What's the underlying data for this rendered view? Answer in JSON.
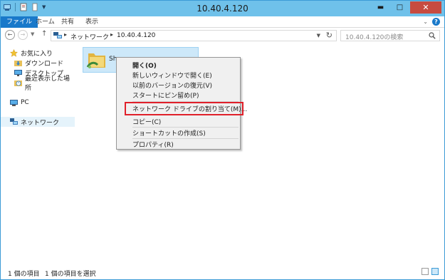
{
  "window": {
    "title": "10.40.4.120",
    "minimize": "▬",
    "maximize": "□",
    "close": "✕"
  },
  "ribbon": {
    "tabs": [
      "ファイル",
      "ホーム",
      "共有",
      "表示"
    ],
    "help": "?"
  },
  "address": {
    "crumbs": [
      "ネットワーク",
      "10.40.4.120"
    ],
    "search_placeholder": "10.40.4.120の検索"
  },
  "nav": {
    "favorites": "お気に入り",
    "downloads": "ダウンロード",
    "desktop": "デスクトップ",
    "recent": "最近表示した場所",
    "pc": "PC",
    "network": "ネットワーク"
  },
  "content": {
    "folder_label": "Sh"
  },
  "context_menu": {
    "items": [
      "開く(O)",
      "新しいウィンドウで開く(E)",
      "以前のバージョンの復元(V)",
      "スタートにピン留め(P)",
      "ネットワーク ドライブの割り当て(M)...",
      "コピー(C)",
      "ショートカットの作成(S)",
      "プロパティ(R)"
    ]
  },
  "status": {
    "count": "1 個の項目",
    "selected": "1 個の項目を選択"
  },
  "colors": {
    "titlebar": "#6fc1ea",
    "file_tab": "#1979ca",
    "highlight": "#e0202a",
    "selection": "#cde8f9"
  }
}
